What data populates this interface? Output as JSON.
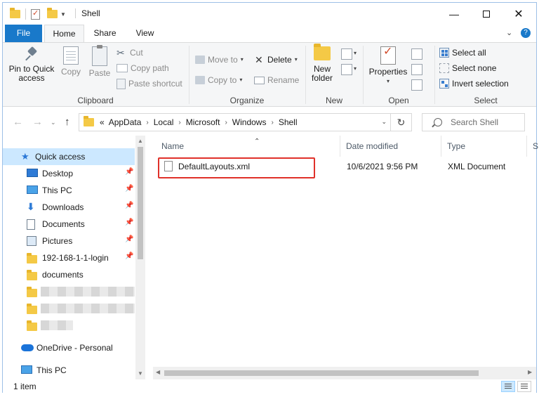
{
  "window": {
    "title": "Shell"
  },
  "tabs": {
    "file": "File",
    "home": "Home",
    "share": "Share",
    "view": "View"
  },
  "ribbon": {
    "clipboard": {
      "label": "Clipboard",
      "pin": "Pin to Quick access",
      "copy": "Copy",
      "paste": "Paste",
      "cut": "Cut",
      "copy_path": "Copy path",
      "paste_shortcut": "Paste shortcut"
    },
    "organize": {
      "label": "Organize",
      "move_to": "Move to",
      "copy_to": "Copy to",
      "delete": "Delete",
      "rename": "Rename"
    },
    "new": {
      "label": "New",
      "new_folder_line1": "New",
      "new_folder_line2": "folder"
    },
    "open": {
      "label": "Open",
      "properties": "Properties"
    },
    "select": {
      "label": "Select",
      "select_all": "Select all",
      "select_none": "Select none",
      "invert_selection": "Invert selection"
    }
  },
  "address": {
    "overflow": "«",
    "crumbs": [
      "AppData",
      "Local",
      "Microsoft",
      "Windows",
      "Shell"
    ]
  },
  "search": {
    "placeholder": "Search Shell"
  },
  "nav": {
    "quick_access": "Quick access",
    "items": [
      "Desktop",
      "This PC",
      "Downloads",
      "Documents",
      "Pictures",
      "192-168-1-1-login",
      "documents"
    ],
    "onedrive": "OneDrive - Personal",
    "this_pc": "This PC"
  },
  "columns": {
    "name": "Name",
    "date": "Date modified",
    "type": "Type",
    "size": "S"
  },
  "files": [
    {
      "name": "DefaultLayouts.xml",
      "date": "10/6/2021 9:56 PM",
      "type": "XML Document"
    }
  ],
  "status": {
    "count": "1 item"
  }
}
